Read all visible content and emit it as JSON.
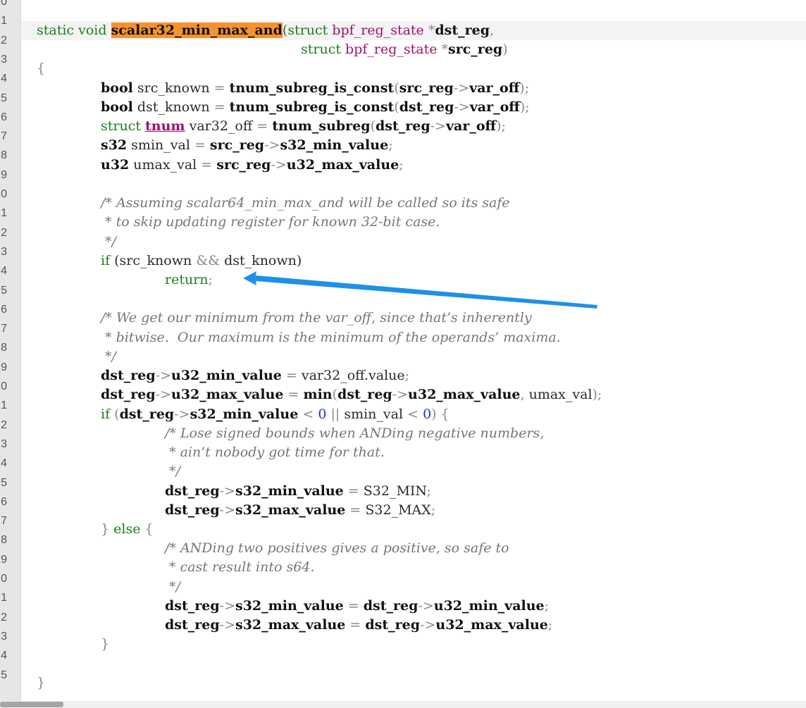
{
  "gutter": {
    "line_numbers": [
      "0",
      "1",
      "2",
      "3",
      "4",
      "5",
      "6",
      "7",
      "8",
      "9",
      "0",
      "1",
      "2",
      "3",
      "4",
      "5",
      "6",
      "7",
      "8",
      "9",
      "0",
      "1",
      "2",
      "3",
      "4",
      "5",
      "6",
      "7",
      "8",
      "9",
      "0",
      "1",
      "2",
      "3",
      "4",
      "5"
    ]
  },
  "code": {
    "l0": [
      "static void ",
      "scalar32_min_max_and",
      "(struct ",
      "bpf_reg_state",
      " *",
      "dst_reg",
      ","
    ],
    "l1": [
      "struct ",
      "bpf_reg_state",
      " *",
      "src_reg",
      ")"
    ],
    "l2": [
      "{"
    ],
    "l3": [
      "bool",
      " src_known ",
      "=",
      " ",
      "tnum_subreg_is_const",
      "(",
      "src_reg",
      "->",
      "var_off",
      ");"
    ],
    "l4": [
      "bool",
      " dst_known ",
      "=",
      " ",
      "tnum_subreg_is_const",
      "(",
      "dst_reg",
      "->",
      "var_off",
      ");"
    ],
    "l5": [
      "struct ",
      "tnum",
      " var32_off ",
      "=",
      " ",
      "tnum_subreg",
      "(",
      "dst_reg",
      "->",
      "var_off",
      ");"
    ],
    "l6": [
      "s32",
      " smin_val ",
      "=",
      " ",
      "src_reg",
      "->",
      "s32_min_value",
      ";"
    ],
    "l7": [
      "u32",
      " umax_val ",
      "=",
      " ",
      "src_reg",
      "->",
      "u32_max_value",
      ";"
    ],
    "l9": [
      "/* Assuming scalar64_min_max_and will be called so its safe"
    ],
    "l10": [
      " * to skip updating register for known 32-bit case."
    ],
    "l11": [
      " */"
    ],
    "l12": [
      "if",
      " (src_known ",
      "&&",
      " dst_known)"
    ],
    "l13": [
      "return",
      ";"
    ],
    "l15": [
      "/* We get our minimum from the var_off, since that’s inherently"
    ],
    "l16": [
      " * bitwise.  Our maximum is the minimum of the operands’ maxima."
    ],
    "l17": [
      " */"
    ],
    "l18": [
      "dst_reg",
      "->",
      "u32_min_value",
      " ",
      "=",
      " var32_off.",
      "value",
      ";"
    ],
    "l19": [
      "dst_reg",
      "->",
      "u32_max_value",
      " ",
      "=",
      " ",
      "min",
      "(",
      "dst_reg",
      "->",
      "u32_max_value",
      ",",
      " umax_val",
      ");"
    ],
    "l20": [
      "if",
      " (",
      "dst_reg",
      "->",
      "s32_min_value",
      " ",
      "<",
      " ",
      "0",
      " ",
      "||",
      " smin_val ",
      "<",
      " ",
      "0",
      ")",
      " {"
    ],
    "l21": [
      "/* Lose signed bounds when ANDing negative numbers,"
    ],
    "l22": [
      " * ain’t nobody got time for that."
    ],
    "l23": [
      " */"
    ],
    "l24": [
      "dst_reg",
      "->",
      "s32_min_value",
      " ",
      "=",
      " ",
      "S32_MIN",
      ";"
    ],
    "l25": [
      "dst_reg",
      "->",
      "s32_max_value",
      " ",
      "=",
      " ",
      "S32_MAX",
      ";"
    ],
    "l26": [
      "}",
      " ",
      "else",
      " ",
      "{"
    ],
    "l27": [
      "/* ANDing two positives gives a positive, so safe to"
    ],
    "l28": [
      " * cast result into s64."
    ],
    "l29": [
      " */"
    ],
    "l30": [
      "dst_reg",
      "->",
      "s32_min_value",
      " ",
      "=",
      " ",
      "dst_reg",
      "->",
      "u32_min_value",
      ";"
    ],
    "l31": [
      "dst_reg",
      "->",
      "s32_max_value",
      " ",
      "=",
      " ",
      "dst_reg",
      "->",
      "u32_max_value",
      ";"
    ],
    "l32": [
      "}"
    ],
    "l34": [
      "}"
    ]
  },
  "colors": {
    "keyword": "#1e7a1e",
    "type": "#a0106e",
    "number": "#1f2fcc",
    "comment": "#767676",
    "highlight": "#f4932e",
    "arrow": "#1e90e8",
    "gutter": "#e6e6e6"
  },
  "annotation": {
    "icon": "arrow-left-icon"
  }
}
